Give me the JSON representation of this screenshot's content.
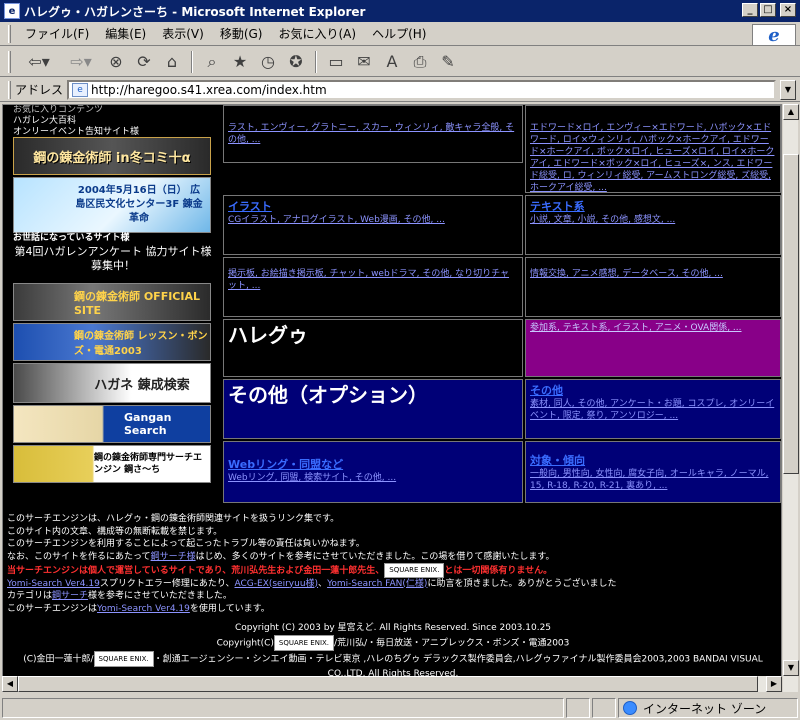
{
  "window": {
    "title": "ハレグゥ・ハガレンさーち - Microsoft Internet Explorer",
    "buttons": [
      "_",
      "□",
      "×"
    ]
  },
  "menu": [
    "ファイル(F)",
    "編集(E)",
    "表示(V)",
    "移動(G)",
    "お気に入り(A)",
    "ヘルプ(H)"
  ],
  "toolbar": {
    "buttons": [
      "back-icon",
      "forward-icon",
      "stop-icon",
      "refresh-icon",
      "home-icon",
      "search-icon",
      "favorites-icon",
      "history-icon",
      "channels-icon",
      "fullscreen-icon",
      "mail-icon",
      "font-icon",
      "print-icon",
      "edit-icon"
    ]
  },
  "address": {
    "label": "アドレス",
    "url": "http://haregoo.s41.xrea.com/index.htm"
  },
  "left": {
    "top_lines": [
      "お気に入りコンテンツ",
      "ハガレン大百科",
      "オンリーイベント告知サイト様"
    ],
    "banner1": "鋼の錬金術師 in冬コミ十α",
    "banner2": "2004年5月16日（日） 広島区民文化センター3F 錬金革命",
    "sponsor_label": "お世話になっているサイト様",
    "recruit": "第4回ハガレンアンケート 協力サイト様募集中！",
    "banner3": "鋼の錬金術師 OFFICIAL SITE",
    "banner4": "鋼の錬金術師 レッスン・ボンズ・電通2003",
    "banner5": "ハガネ 錬成検索",
    "banner6": "Gangan Search",
    "banner7": "鋼の錬金術師専門サーチエンジン 鋼さ～ち"
  },
  "grid": {
    "c1_sub": "ラスト, エンヴィー, グラトニー, スカー, ウィンリィ, 敵キャラ全般, その他, ...",
    "c2_sub": "エドワード×ロイ, エンヴィー×エドワード, ハボック×エドワード, ロイ×ウィンリィ, ハボック×ホークアイ, エドワード×ホークアイ, ボック×ロイ, ヒューズ×ロイ, ロイ×ホークアイ, エドワード×ボック×ロイ, ヒューズ×, ンス, エドワード総受, ロ, ウィンリィ総受, アームストロング総受, ズ総受, ホークアイ総受, ...",
    "c3_title": "イラスト",
    "c3_sub": "CGイラスト, アナログイラスト, Web漫画, その他, ...",
    "c4_title": "テキスト系",
    "c4_sub": "小説, 文章, 小説, その他, 感想文, ...",
    "c5_sub": "掲示板, お絵描き掲示板, チャット, webドラマ, その他, なり切りチャット, ...",
    "c6_sub": "情報交換, アニメ感想, データベース, その他, ...",
    "c7_title": "ハレグゥ",
    "c7_sub": "参加系, テキスト系, イラスト, アニメ・OVA関係, ...",
    "c8_title": "その他（オプション）",
    "c8_sub_title": "その他",
    "c8_sub": "素材, 同人, その他, アンケート・お題, コスプレ, オンリーイベント, 限定, 祭り, アンソロジー, ...",
    "c9_title": "Webリング・同盟など",
    "c9_sub": "Webリング, 同盟, 検索サイト, その他, ...",
    "c10_title": "対象・傾向",
    "c10_sub": "一般向, 男性向, 女性向, 腐女子向, オールキャラ, ノーマル, 15, R-18, R-20, R-21, 裏あり, ..."
  },
  "info": {
    "line1": "このサーチエンジンは、ハレグゥ・鋼の錬金術師関連サイトを扱うリンク集です。",
    "line2": "このサイト内の文章、構成等の無断転載を禁じます。",
    "line3": "このサーチエンジンを利用することによって起こったトラブル等の責任は負いかねます。",
    "line4a": "なお、このサイトを作るにあたって",
    "line4_link": "鋼サーチ様",
    "line4b": "はじめ、多くのサイトを参考にさせていただきました。この場を借りて感謝いたします。",
    "line5a": "当サーチエンジンは個人で運営しているサイトであり、荒川弘先生および金田一蓮十郎先生、",
    "line5_badge": "SQUARE ENIX.",
    "line5b": "とは一切関係有りません。",
    "line6a": "Yomi-Search Ver4.19",
    "line6b": "スプリクトエラー修理にあたり、",
    "line6_link1": "ACG-EX(seiryuu様)",
    "line6c": "、",
    "line6_link2": "Yomi-Search FAN(仁様)",
    "line6d": "に助言を頂きました。ありがとうございました",
    "line7a": "カテゴリは",
    "line7_link": "鋼サーチ",
    "line7b": "様を参考にさせていただきました。",
    "line8a": "このサーチエンジンは",
    "line8_link": "Yomi-Search Ver4.19",
    "line8b": "を使用しています。"
  },
  "copyright": {
    "line1": "Copyright (C) 2003 by 星宮えど. All Rights Reserved.  Since 2003.10.25",
    "line2a": "Copyright(C)",
    "line2_badge": "SQUARE ENIX.",
    "line2b": "/荒川弘/・毎日放送・アニプレックス・ボンズ・電通2003",
    "line3a": "(C)金田一蓮十郎/",
    "line3_badge": "SQUARE ENIX.",
    "line3b": "・創通エージェンシー・シンエイ動画・テレビ東京 ,ハレのちグゥ デラックス製作委員会,ハレグゥファイナル製作委員会2003,2003 BANDAI VISUAL",
    "line4": "CO.,LTD. All Rights Reserved."
  },
  "status": {
    "zone": "インターネット ゾーン"
  }
}
